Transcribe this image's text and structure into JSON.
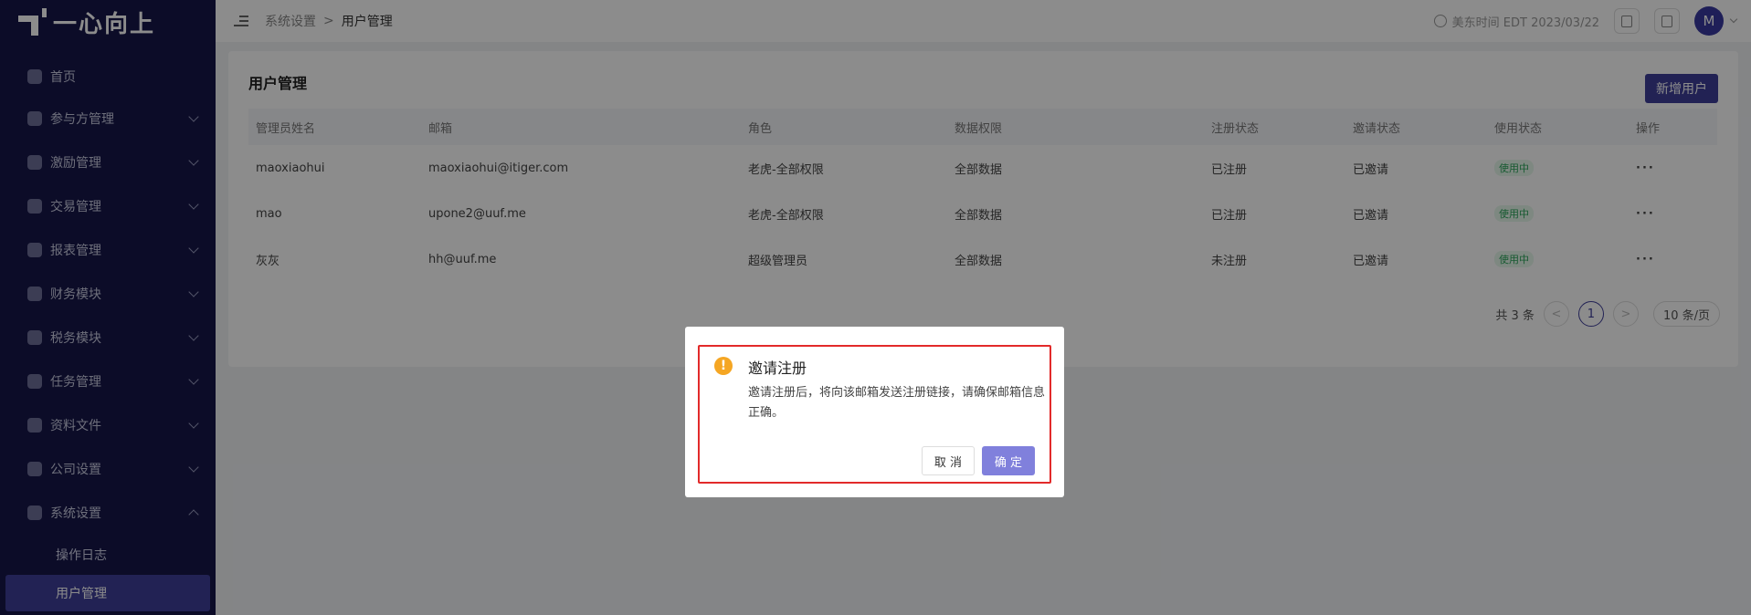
{
  "app": {
    "logo_text": "一心向上"
  },
  "sidebar": {
    "items": [
      {
        "label": "首页",
        "icon": "home-icon"
      },
      {
        "label": "参与方管理",
        "icon": "participants-icon"
      },
      {
        "label": "激励管理",
        "icon": "incentive-icon"
      },
      {
        "label": "交易管理",
        "icon": "trade-icon"
      },
      {
        "label": "报表管理",
        "icon": "report-icon"
      },
      {
        "label": "财务模块",
        "icon": "finance-icon"
      },
      {
        "label": "税务模块",
        "icon": "tax-icon"
      },
      {
        "label": "任务管理",
        "icon": "task-icon"
      },
      {
        "label": "资料文件",
        "icon": "file-icon"
      },
      {
        "label": "公司设置",
        "icon": "company-icon"
      },
      {
        "label": "系统设置",
        "icon": "settings-icon"
      }
    ],
    "sub_items": [
      {
        "label": "操作日志"
      },
      {
        "label": "用户管理"
      }
    ]
  },
  "header": {
    "breadcrumb": [
      "系统设置",
      "用户管理"
    ],
    "separator": ">",
    "time_label": "美东时间 EDT 2023/03/22",
    "avatar_initial": "M"
  },
  "page": {
    "title": "用户管理",
    "add_button": "新增用户",
    "columns": [
      "管理员姓名",
      "邮箱",
      "角色",
      "数据权限",
      "注册状态",
      "邀请状态",
      "使用状态",
      "操作"
    ],
    "rows": [
      {
        "name": "maoxiaohui",
        "email": "maoxiaohui@itiger.com",
        "role": "老虎-全部权限",
        "data_perm": "全部数据",
        "reg_status": "已注册",
        "invite_status": "已邀请",
        "use_status": "使用中",
        "action": "···"
      },
      {
        "name": "mao",
        "email": "upone2@uuf.me",
        "role": "老虎-全部权限",
        "data_perm": "全部数据",
        "reg_status": "已注册",
        "invite_status": "已邀请",
        "use_status": "使用中",
        "action": "···"
      },
      {
        "name": "灰灰",
        "email": "hh@uuf.me",
        "role": "超级管理员",
        "data_perm": "全部数据",
        "reg_status": "未注册",
        "invite_status": "已邀请",
        "use_status": "使用中",
        "action": "···"
      }
    ],
    "pagination": {
      "total": "共 3 条",
      "prev": "<",
      "current": "1",
      "next": ">",
      "page_size": "10 条/页"
    }
  },
  "modal": {
    "icon": "warning-icon",
    "title": "邀请注册",
    "body": "邀请注册后，将向该邮箱发送注册链接，请确保邮箱信息正确。",
    "cancel": "取 消",
    "ok": "确 定"
  }
}
